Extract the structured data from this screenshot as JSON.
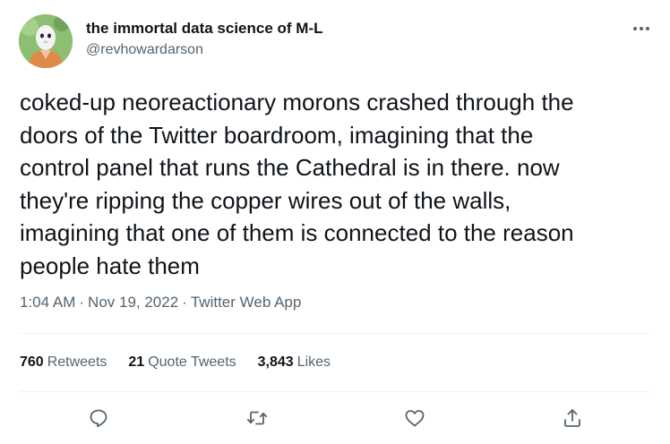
{
  "user": {
    "display_name": "the immortal data science of M-L",
    "handle": "@revhowardarson",
    "avatar_icon": "avatar-figure"
  },
  "tweet": {
    "text": "coked-up neoreactionary morons crashed through the\ndoors of the Twitter boardroom, imagining that the\ncontrol panel that runs the Cathedral is in there. now\nthey're ripping the copper wires out of the walls,\nimagining that one of them is connected to the reason\npeople hate them",
    "time": "1:04 AM",
    "date": "Nov 19, 2022",
    "source": "Twitter Web App",
    "separator": "·"
  },
  "stats": {
    "retweets_count": "760",
    "retweets_label": "Retweets",
    "quotes_count": "21",
    "quotes_label": "Quote Tweets",
    "likes_count": "3,843",
    "likes_label": "Likes"
  },
  "actions": {
    "reply_icon": "reply-icon",
    "retweet_icon": "retweet-icon",
    "like_icon": "heart-icon",
    "share_icon": "share-icon",
    "more_icon": "more-icon"
  },
  "colors": {
    "text": "#0f1419",
    "secondary": "#536471",
    "divider": "#eff3f4"
  }
}
